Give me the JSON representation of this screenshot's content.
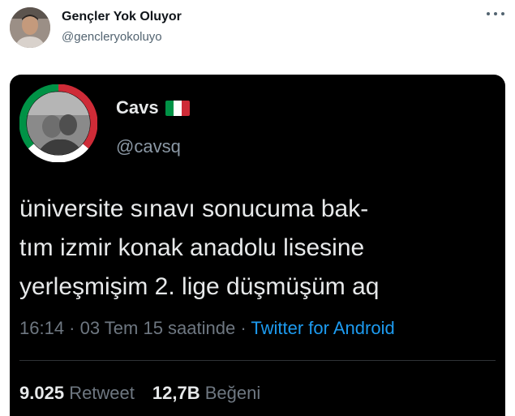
{
  "author": {
    "name": "Gençler Yok Oluyor",
    "handle": "@gencleryokoluyo"
  },
  "quoted": {
    "name": "Cavs",
    "flag_icon": "italy-flag-icon",
    "handle": "@cavsq",
    "text": "üniversite sınavı sonucuma bak-\ntım izmir konak anadolu lisesine\nyerleşmişim 2. lige düşmüşüm aq",
    "meta_prefix": "16:14 · 03 Tem 15 saatinde · ",
    "source": "Twitter for Android",
    "retweets_count": "9.025",
    "retweets_label": "Retweet",
    "likes_count": "12,7B",
    "likes_label": "Beğeni"
  },
  "colors": {
    "embed_bg": "#000000",
    "link": "#1d9bf0",
    "flag_green": "#009246",
    "flag_white": "#ffffff",
    "flag_red": "#ce2b37"
  }
}
